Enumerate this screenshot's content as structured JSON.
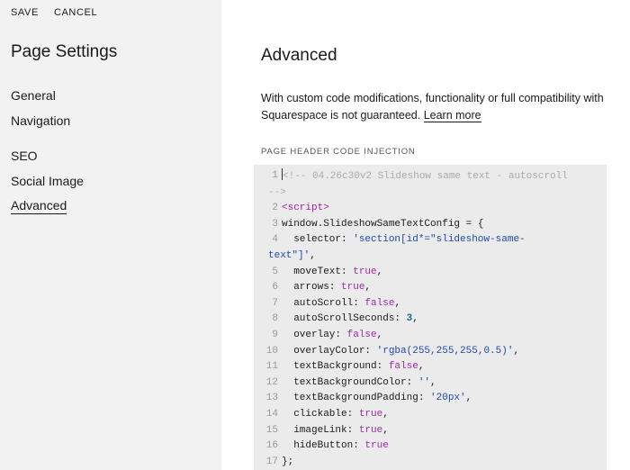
{
  "topbar": {
    "save_label": "SAVE",
    "cancel_label": "CANCEL"
  },
  "sidebar": {
    "title": "Page Settings",
    "group1": [
      "General",
      "Navigation"
    ],
    "group2": [
      "SEO",
      "Social Image",
      "Advanced"
    ],
    "active": "Advanced"
  },
  "main": {
    "title": "Advanced",
    "description": "With custom code modifications, functionality or full compatibility with Squarespace is not guaranteed. ",
    "learn_more": "Learn more",
    "section_label": "PAGE HEADER CODE INJECTION"
  },
  "code": {
    "lines": [
      {
        "n": "1",
        "parts": [
          [
            "comment",
            "<!-- 04.26c30v2 Slideshow same text - autoscroll"
          ]
        ],
        "wrap": [
          [
            "comment",
            "-->"
          ]
        ]
      },
      {
        "n": "2",
        "parts": [
          [
            "tag",
            "<script>"
          ]
        ]
      },
      {
        "n": "3",
        "parts": [
          [
            "plain",
            "window.SlideshowSameTextConfig = {"
          ]
        ]
      },
      {
        "n": "4",
        "parts": [
          [
            "plain",
            "  selector: "
          ],
          [
            "str",
            "'section[id*=\"slideshow-same-"
          ]
        ],
        "wrap": [
          [
            "str",
            "text\"]'"
          ],
          [
            "plain",
            ","
          ]
        ]
      },
      {
        "n": "5",
        "parts": [
          [
            "plain",
            "  moveText: "
          ],
          [
            "kw",
            "true"
          ],
          [
            "plain",
            ","
          ]
        ]
      },
      {
        "n": "6",
        "parts": [
          [
            "plain",
            "  arrows: "
          ],
          [
            "kw",
            "true"
          ],
          [
            "plain",
            ","
          ]
        ]
      },
      {
        "n": "7",
        "parts": [
          [
            "plain",
            "  autoScroll: "
          ],
          [
            "kw",
            "false"
          ],
          [
            "plain",
            ","
          ]
        ]
      },
      {
        "n": "8",
        "parts": [
          [
            "plain",
            "  autoScrollSeconds: "
          ],
          [
            "num",
            "3"
          ],
          [
            "plain",
            ","
          ]
        ]
      },
      {
        "n": "9",
        "parts": [
          [
            "plain",
            "  overlay: "
          ],
          [
            "kw",
            "false"
          ],
          [
            "plain",
            ","
          ]
        ]
      },
      {
        "n": "10",
        "parts": [
          [
            "plain",
            "  overlayColor: "
          ],
          [
            "str",
            "'rgba(255,255,255,0.5)'"
          ],
          [
            "plain",
            ","
          ]
        ]
      },
      {
        "n": "11",
        "parts": [
          [
            "plain",
            "  textBackground: "
          ],
          [
            "kw",
            "false"
          ],
          [
            "plain",
            ","
          ]
        ]
      },
      {
        "n": "12",
        "parts": [
          [
            "plain",
            "  textBackgroundColor: "
          ],
          [
            "str",
            "''"
          ],
          [
            "plain",
            ","
          ]
        ]
      },
      {
        "n": "13",
        "parts": [
          [
            "plain",
            "  textBackgroundPadding: "
          ],
          [
            "str",
            "'20px'"
          ],
          [
            "plain",
            ","
          ]
        ]
      },
      {
        "n": "14",
        "parts": [
          [
            "plain",
            "  clickable: "
          ],
          [
            "kw",
            "true"
          ],
          [
            "plain",
            ","
          ]
        ]
      },
      {
        "n": "15",
        "parts": [
          [
            "plain",
            "  imageLink: "
          ],
          [
            "kw",
            "true"
          ],
          [
            "plain",
            ","
          ]
        ]
      },
      {
        "n": "16",
        "parts": [
          [
            "plain",
            "  hideButton: "
          ],
          [
            "kw",
            "true"
          ]
        ]
      },
      {
        "n": "17",
        "parts": [
          [
            "plain",
            "};"
          ]
        ]
      }
    ]
  }
}
